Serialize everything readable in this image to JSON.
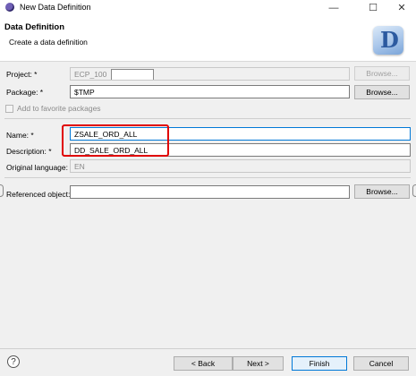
{
  "window": {
    "title": "New Data Definition",
    "minimize_glyph": "—",
    "maximize_glyph": "☐",
    "close_glyph": "✕"
  },
  "header": {
    "title": "Data Definition",
    "subtitle": "Create a data definition",
    "logo_letter": "D"
  },
  "form": {
    "project": {
      "label": "Project: *",
      "value": "ECP_100",
      "button": "Browse..."
    },
    "package": {
      "label": "Package: *",
      "value": "$TMP",
      "button": "Browse..."
    },
    "favorite": {
      "label": "Add to favorite packages"
    },
    "name": {
      "label": "Name: *",
      "value": "ZSALE_ORD_ALL"
    },
    "description": {
      "label": "Description: *",
      "value": "DD_SALE_ORD_ALL"
    },
    "original_language": {
      "label": "Original language:",
      "value": "EN"
    },
    "referenced_object": {
      "label": "Referenced object:",
      "value": "",
      "button": "Browse..."
    }
  },
  "footer": {
    "help_glyph": "?",
    "back": "< Back",
    "next": "Next >",
    "finish": "Finish",
    "cancel": "Cancel"
  },
  "colors": {
    "highlight": "#e00000",
    "focus": "#0078d7"
  }
}
